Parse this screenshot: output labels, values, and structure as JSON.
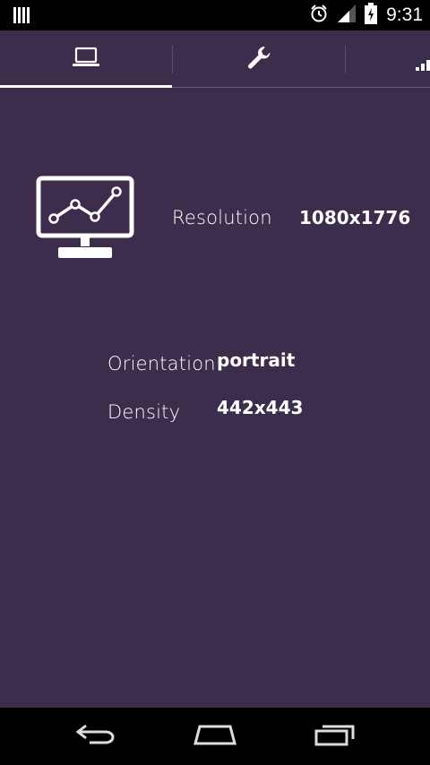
{
  "status_bar": {
    "time": "9:31",
    "icons": [
      "notification-icon",
      "alarm-icon",
      "signal-icon",
      "battery-icon"
    ]
  },
  "tabs": [
    {
      "name": "display-tab",
      "icon": "laptop-icon",
      "selected": true
    },
    {
      "name": "tools-tab",
      "icon": "wrench-icon",
      "selected": false
    },
    {
      "name": "signal-tab",
      "icon": "signal-bars-icon",
      "selected": false
    }
  ],
  "display_info": {
    "resolution_label": "Resolution",
    "resolution_value": "1080x1776",
    "orientation_label": "Orientation",
    "orientation_value": "portrait",
    "density_label": "Density",
    "density_value": "442x443"
  },
  "nav_bar": {
    "icons": [
      "back-icon",
      "home-icon",
      "recent-apps-icon"
    ]
  },
  "colors": {
    "background": "#3c2d4c",
    "foreground": "#ffffff",
    "bars": "#000000"
  }
}
